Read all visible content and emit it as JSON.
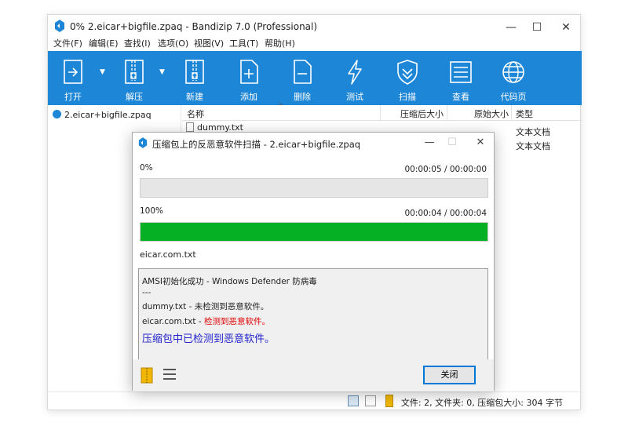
{
  "window": {
    "title": "0% 2.eicar+bigfile.zpaq - Bandizip 7.0 (Professional)",
    "controls": {
      "minimize": "—",
      "maximize": "☐",
      "close": "✕"
    }
  },
  "menu": [
    "文件(F)",
    "编辑(E)",
    "查找(I)",
    "选项(O)",
    "视图(V)",
    "工具(T)",
    "帮助(H)"
  ],
  "toolbar": {
    "open": "打开",
    "extract": "解压",
    "new": "新建",
    "add": "添加",
    "delete": "删除",
    "test": "测试",
    "scan": "扫描",
    "view": "查看",
    "codepage": "代码页"
  },
  "tree": {
    "archive": "2.eicar+bigfile.zpaq"
  },
  "list": {
    "columns": {
      "name": "名称",
      "packed": "压缩后大小",
      "original": "原始大小",
      "type": "类型"
    },
    "rows": [
      {
        "name": "dummy.txt",
        "type": "文本文档"
      },
      {
        "name": "",
        "type": "文本文档"
      }
    ]
  },
  "status": {
    "text": "文件: 2, 文件夹: 0, 压缩包大小: 304 字节"
  },
  "dialog": {
    "title": "压缩包上的反恶意软件扫描 - 2.eicar+bigfile.zpaq",
    "controls": {
      "minimize": "—",
      "maximize": "☐",
      "close": "✕"
    },
    "progress1": {
      "percent_label": "0%",
      "time": "00:00:05 / 00:00:00",
      "value": 0
    },
    "progress2": {
      "percent_label": "100%",
      "time": "00:00:04 / 00:00:04",
      "value": 1
    },
    "current_file": "eicar.com.txt",
    "log": {
      "line1": "AMSI初始化成功 - Windows Defender 防病毒",
      "line2": "---",
      "line3": "dummy.txt - 未检测到恶意软件。",
      "line4_file": "eicar.com.txt - ",
      "line4_result": "检测到恶意软件。",
      "summary": "压缩包中已检测到恶意软件。"
    },
    "close_button": "关闭"
  },
  "colors": {
    "toolbar": "#1e86d6",
    "progress": "#06b025",
    "alert": "#e00000",
    "summary": "#2222cc"
  }
}
